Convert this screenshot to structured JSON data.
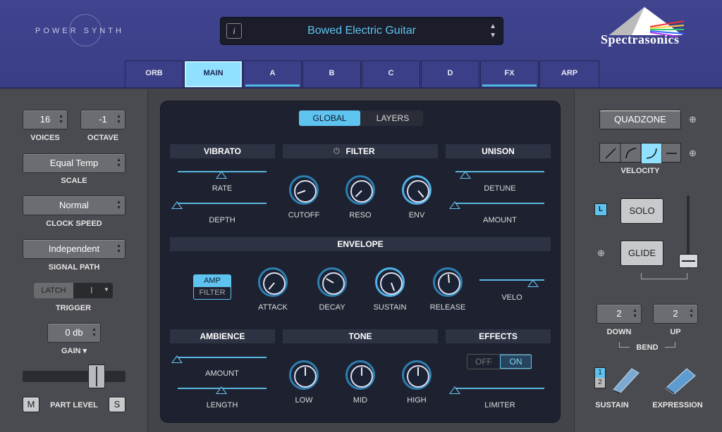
{
  "header": {
    "logo": "POWER SYNTH",
    "preset_info": "i",
    "preset_name": "Bowed Electric Guitar",
    "brand": "Spectrasonics"
  },
  "tabs": [
    "ORB",
    "MAIN",
    "A",
    "B",
    "C",
    "D",
    "FX",
    "ARP"
  ],
  "left": {
    "voices": {
      "value": "16",
      "label": "VOICES"
    },
    "octave": {
      "value": "-1",
      "label": "OCTAVE"
    },
    "scale": {
      "value": "Equal Temp",
      "label": "SCALE"
    },
    "clock_speed": {
      "value": "Normal",
      "label": "CLOCK SPEED"
    },
    "signal_path": {
      "value": "Independent",
      "label": "SIGNAL PATH"
    },
    "trigger": {
      "value": "LATCH",
      "label": "TRIGGER"
    },
    "gain": {
      "value": "0 db",
      "label": "GAIN ▾"
    },
    "part_level": {
      "label": "PART LEVEL",
      "mute": "M",
      "solo": "S"
    }
  },
  "panel": {
    "view_tabs": [
      "GLOBAL",
      "LAYERS"
    ],
    "vibrato": {
      "title": "VIBRATO",
      "rate": "RATE",
      "depth": "DEPTH"
    },
    "filter": {
      "title": "FILTER",
      "cutoff": "CUTOFF",
      "reso": "RESO",
      "env": "ENV"
    },
    "unison": {
      "title": "UNISON",
      "detune": "DETUNE",
      "amount": "AMOUNT"
    },
    "envelope": {
      "title": "ENVELOPE",
      "amp": "AMP",
      "filter": "FILTER",
      "attack": "ATTACK",
      "decay": "DECAY",
      "sustain": "SUSTAIN",
      "release": "RELEASE",
      "velo": "VELO"
    },
    "ambience": {
      "title": "AMBIENCE",
      "amount": "AMOUNT",
      "length": "LENGTH"
    },
    "tone": {
      "title": "TONE",
      "low": "LOW",
      "mid": "MID",
      "high": "HIGH"
    },
    "effects": {
      "title": "EFFECTS",
      "off": "OFF",
      "on": "ON",
      "limiter": "LIMITER"
    }
  },
  "right": {
    "quadzone": "QUADZONE",
    "velocity": "VELOCITY",
    "latch": "L",
    "solo": "SOLO",
    "glide": "GLIDE",
    "bend_down": {
      "value": "2",
      "label": "DOWN"
    },
    "bend_up": {
      "value": "2",
      "label": "UP"
    },
    "bend": "BEND",
    "sustain": "SUSTAIN",
    "expression": "EXPRESSION",
    "sustain_modes": [
      "1",
      "2"
    ]
  },
  "colors": {
    "accent": "#5fc4f0",
    "header": "#3d4189",
    "panel": "#1e2230"
  }
}
